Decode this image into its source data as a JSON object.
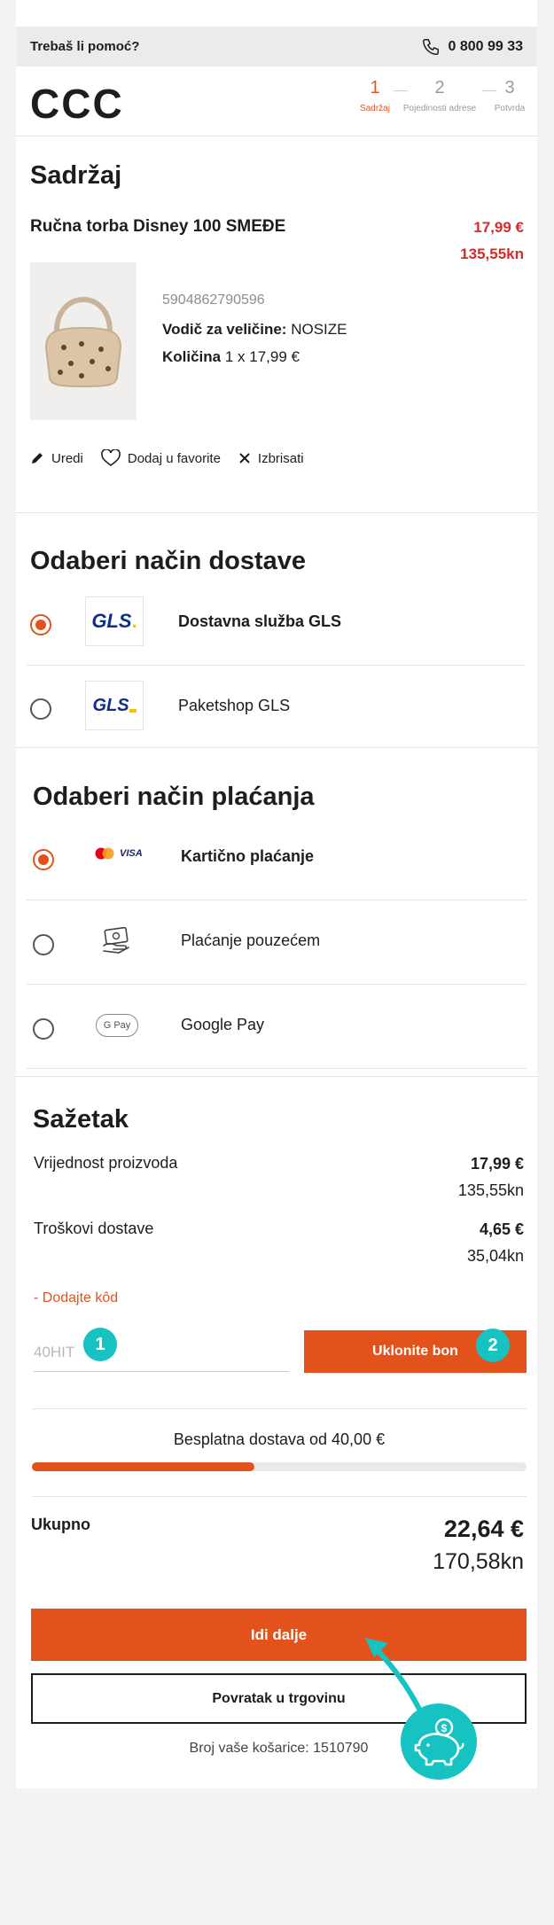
{
  "help": {
    "label": "Trebaš li pomoć?",
    "phone": "0 800 99 33"
  },
  "logo": "CCC",
  "steps": [
    {
      "num": "1",
      "label": "Sadržaj"
    },
    {
      "num": "2",
      "label": "Pojedinosti adrese"
    },
    {
      "num": "3",
      "label": "Potvrda"
    }
  ],
  "content": {
    "title": "Sadržaj",
    "product": {
      "name": "Ručna torba Disney 100 SMEĐE",
      "price_eur": "17,99 €",
      "price_kn": "135,55kn",
      "ean": "5904862790596",
      "size_label": "Vodič za veličine:",
      "size_value": "NOSIZE",
      "qty_label": "Količina",
      "qty_value": "1 x 17,99 €"
    },
    "actions": {
      "edit": "Uredi",
      "favorite": "Dodaj u favorite",
      "delete": "Izbrisati"
    }
  },
  "delivery": {
    "title": "Odaberi način dostave",
    "options": [
      {
        "label": "Dostavna služba GLS",
        "logo": "GLS",
        "selected": true
      },
      {
        "label": "Paketshop GLS",
        "logo": "GLS",
        "selected": false
      }
    ]
  },
  "payment": {
    "title": "Odaberi način plaćanja",
    "options": [
      {
        "label": "Kartično plaćanje",
        "icon": "card-icon",
        "selected": true
      },
      {
        "label": "Plaćanje pouzećem",
        "icon": "cash-icon",
        "selected": false
      },
      {
        "label": "Google Pay",
        "icon": "google-pay-icon",
        "selected": false
      }
    ],
    "visa_text": "VISA",
    "gpay_text": "G Pay"
  },
  "summary": {
    "title": "Sažetak",
    "product_label": "Vrijednost proizvoda",
    "product_eur": "17,99 €",
    "product_kn": "135,55kn",
    "shipping_label": "Troškovi dostave",
    "shipping_eur": "4,65 €",
    "shipping_kn": "35,04kn",
    "code_link": "- Dodajte kôd",
    "code_value": "40HIT",
    "remove_button": "Uklonite bon",
    "free_shipping": "Besplatna dostava od 40,00 €",
    "free_shipping_progress": 0.45,
    "total_label": "Ukupno",
    "total_eur": "22,64 €",
    "total_kn": "170,58kn",
    "continue_button": "Idi dalje",
    "back_button": "Povratak u trgovinu",
    "cart_number": "Broj vaše košarice: 1510790"
  },
  "badges": {
    "one": "1",
    "two": "2"
  },
  "colors": {
    "accent": "#e4521b",
    "price_red": "#d42c2c",
    "teal": "#17c2c2"
  }
}
